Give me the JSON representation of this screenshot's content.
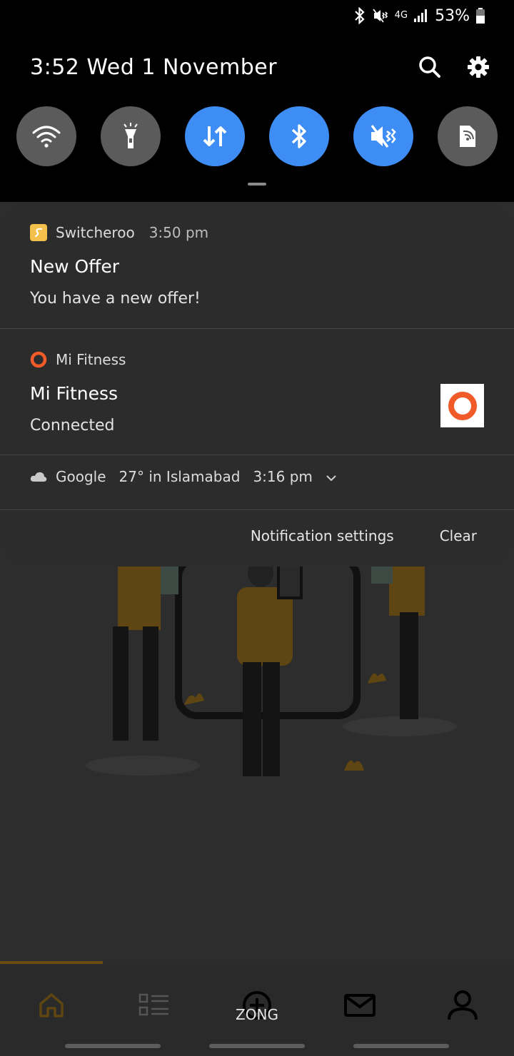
{
  "status_bar": {
    "network": "4G",
    "battery": "53%"
  },
  "header": {
    "datetime": "3:52  Wed 1 November"
  },
  "quick_toggles": [
    {
      "icon": "wifi-icon",
      "active": false
    },
    {
      "icon": "flashlight-icon",
      "active": false
    },
    {
      "icon": "mobile-data-icon",
      "active": true
    },
    {
      "icon": "bluetooth-icon",
      "active": true
    },
    {
      "icon": "vibrate-icon",
      "active": true
    },
    {
      "icon": "screen-cast-icon",
      "active": false
    }
  ],
  "notifications": [
    {
      "app": "Switcheroo",
      "time": "3:50 pm",
      "title": "New Offer",
      "body": "You have a new offer!",
      "icon_color": "#f3c14b"
    },
    {
      "app": "Mi Fitness",
      "title": "Mi Fitness",
      "body": "Connected",
      "icon_color": "#f15a29"
    },
    {
      "app": "Google",
      "summary": "27° in Islamabad",
      "time": "3:16 pm"
    }
  ],
  "actions": {
    "settings": "Notification settings",
    "clear": "Clear"
  },
  "background_app": {
    "carrier": "ZONG",
    "accent_color": "#e0a81f"
  }
}
